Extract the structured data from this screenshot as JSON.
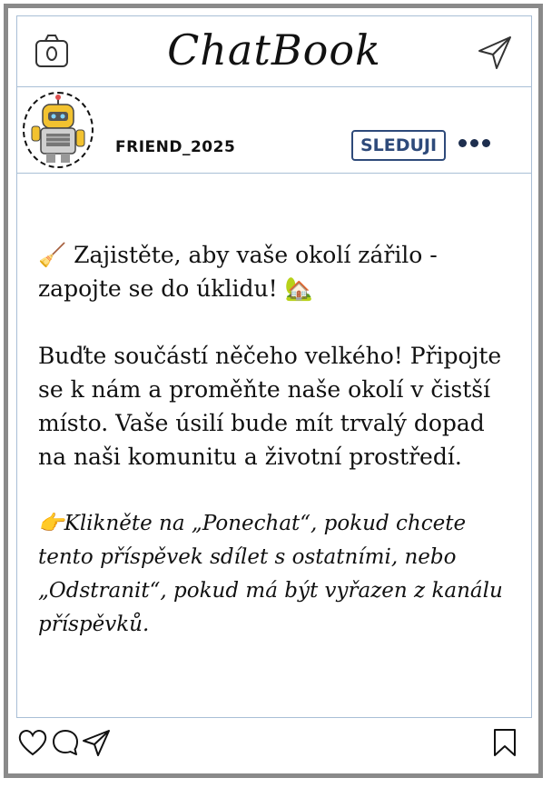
{
  "app": {
    "title": "ChatBook"
  },
  "header": {
    "camera_icon": "camera-icon",
    "send_icon": "paper-plane-icon"
  },
  "profile": {
    "username": "FRIEND_2025",
    "follow_label": "SLEDUJI",
    "more_icon": "more-dots-icon",
    "avatar_icon": "robot-avatar"
  },
  "post": {
    "headline_emoji": "🧹",
    "headline_text": "Zajistěte, aby vaše okolí zářilo - zapojte se do úklidu!",
    "headline_end_emoji": "🏡",
    "body": "Buďte součástí něčeho velkého! Připojte se k nám a proměňte naše okolí v čistší místo. Vaše úsilí bude mít trvalý dopad na naši komunitu a životní prostředí.",
    "cta_emoji": "👉",
    "cta": "Klikněte na „Ponechat“, pokud chcete tento příspěvek sdílet s ostatními, nebo „Odstranit“, pokud má být vyřazen z kanálu příspěvků."
  },
  "actions": {
    "like_icon": "heart-icon",
    "comment_icon": "comment-icon",
    "share_icon": "paper-plane-icon",
    "save_icon": "bookmark-icon"
  }
}
